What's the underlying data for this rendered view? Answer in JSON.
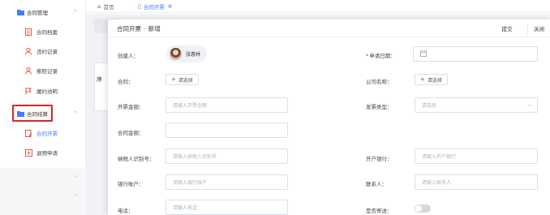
{
  "sidebar": {
    "group_contract": {
      "label": "合同管理",
      "icon": "folder-icon"
    },
    "items_contract": [
      {
        "label": "合同档案",
        "icon": "document-icon"
      },
      {
        "label": "违约记录",
        "icon": "user-warning-icon"
      },
      {
        "label": "索赔记录",
        "icon": "user-claim-icon"
      },
      {
        "label": "履约池明",
        "icon": "flag-icon"
      }
    ],
    "group_settlement": {
      "label": "合同结算",
      "icon": "folder-icon"
    },
    "items_settlement": [
      {
        "label": "合同开票",
        "icon": "invoice-icon"
      },
      {
        "label": "退预申请",
        "icon": "refund-icon"
      }
    ],
    "accent_color": "#3d7eff",
    "highlight_color": "#e02424"
  },
  "tabs": [
    {
      "label": "首页",
      "icon": "home-icon"
    },
    {
      "label": "合同开票",
      "icon": "invoice-icon"
    }
  ],
  "background_page": {
    "partial_text": "序"
  },
  "drawer": {
    "title": "合同开票",
    "separator": "-",
    "mode": "新增",
    "submit_label": "提交",
    "close_label": "关闭",
    "fields": {
      "creator": {
        "label": "创建人：",
        "value": "张惠林"
      },
      "apply_date": {
        "label": "申请日期：",
        "required": "*"
      },
      "contract": {
        "label": "合同：",
        "button": "请选择"
      },
      "company": {
        "label": "公司名称：",
        "button": "请选择"
      },
      "invoice_amount": {
        "label": "开票金额：",
        "placeholder": "请输入开票金额"
      },
      "invoice_type": {
        "label": "发票类型：",
        "placeholder": "请选择"
      },
      "contract_amount": {
        "label": "合同金额：",
        "value": ""
      },
      "tax_id": {
        "label": "纳税人识别号：",
        "placeholder": "请输入纳税人识别号"
      },
      "bank": {
        "label": "开户银行：",
        "placeholder": "请输入开户银行"
      },
      "bank_account": {
        "label": "银行账户：",
        "placeholder": "请输入银行账户"
      },
      "contact": {
        "label": "联系人：",
        "placeholder": "请输入联系人"
      },
      "phone": {
        "label": "电话：",
        "placeholder": "请输入电话"
      },
      "mail": {
        "label": "是否寄送：",
        "toggle_on": false
      }
    }
  }
}
